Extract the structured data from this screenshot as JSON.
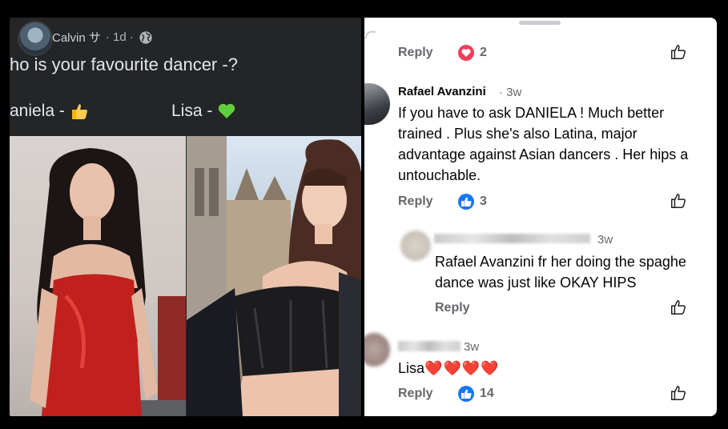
{
  "post": {
    "author": "Calvin サ",
    "time": "· 1d ·",
    "text": "ho is your favourite dancer -?",
    "option_a": "aniela -",
    "option_b": "Lisa -"
  },
  "thread": {
    "top_reply": {
      "reply_label": "Reply",
      "reaction_count": "2"
    },
    "comment1": {
      "name": "Rafael Avanzini",
      "time": "· 3w",
      "lines": [
        "If you have to ask DANIELA ! Much better",
        "trained . Plus she's also Latina, major",
        "advantage against Asian dancers . Her hips a",
        "untouchable."
      ],
      "reply_label": "Reply",
      "reaction_count": "3"
    },
    "comment2": {
      "time": "3w",
      "lines": [
        "Rafael Avanzini fr her doing the spaghe",
        "dance was just like OKAY HIPS"
      ],
      "reply_label": "Reply"
    },
    "comment3": {
      "time": "3w",
      "text": "Lisa",
      "hearts": "❤️❤️❤️❤️",
      "reply_label": "Reply",
      "reaction_count": "14"
    }
  },
  "colors": {
    "reply_grey": "#65676b",
    "like_blue": "#1877f2",
    "love_red": "#f33e58"
  }
}
